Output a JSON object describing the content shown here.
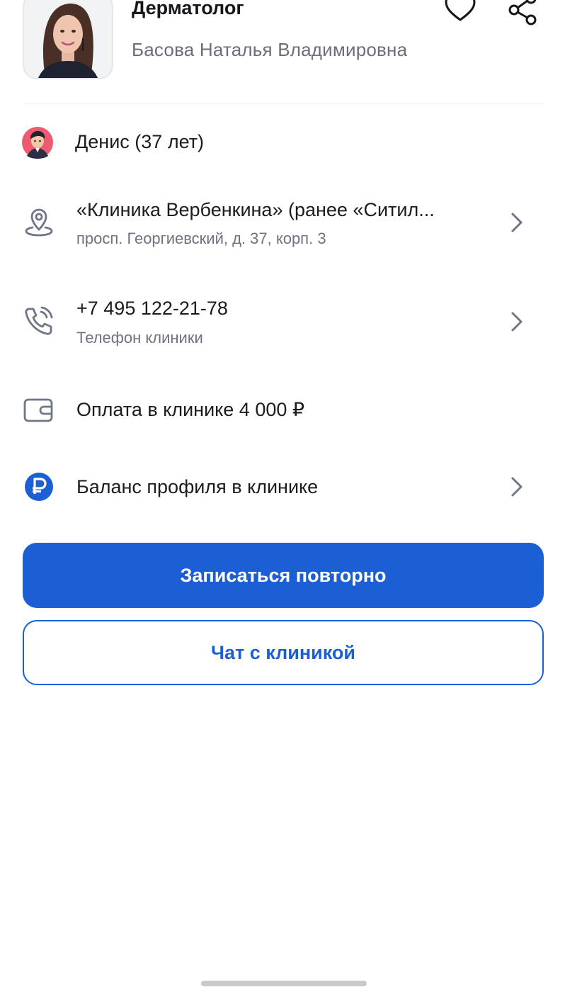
{
  "doctor": {
    "specialty": "Дерматолог",
    "name": "Басова Наталья Владимировна"
  },
  "actions": {
    "favorite_icon": "heart-icon",
    "share_icon": "share-icon"
  },
  "patient": {
    "label": "Денис (37 лет)",
    "icon": "avatar-icon"
  },
  "clinic": {
    "title": "«Клиника Вербенкина» (ранее «Ситил...",
    "address": "просп. Георгиевский, д. 37, корп. 3",
    "icon": "location-pin-icon"
  },
  "phone": {
    "number": "+7 495 122-21-78",
    "caption": "Телефон клиники",
    "icon": "phone-icon"
  },
  "payment": {
    "label": "Оплата в клинике 4 000 ₽",
    "icon": "wallet-icon"
  },
  "balance": {
    "label": "Баланс профиля в клинике",
    "icon": "ruble-icon"
  },
  "buttons": {
    "rebook": "Записаться повторно",
    "chat": "Чат с клиникой"
  },
  "colors": {
    "accent": "#1c5fd4",
    "icon_gray": "#6f7685",
    "text": "#1b1c22",
    "muted": "#6f7280"
  }
}
